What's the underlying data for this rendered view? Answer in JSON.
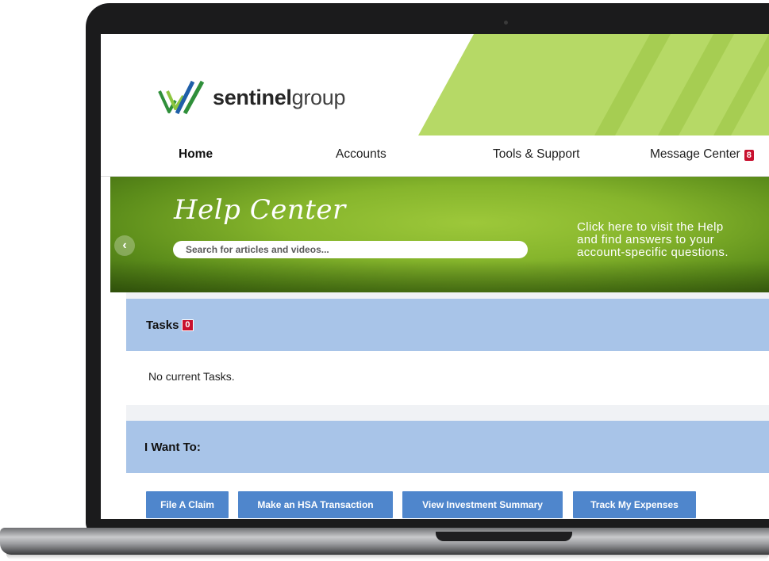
{
  "brand": {
    "name_bold": "sentinel",
    "name_light": "group",
    "colors": {
      "green": "#8dc63f",
      "dark_green": "#2e7d32",
      "blue": "#1f5fa8"
    }
  },
  "nav": {
    "items": [
      {
        "label": "Home",
        "active": true
      },
      {
        "label": "Accounts"
      },
      {
        "label": "Tools & Support"
      },
      {
        "label": "Message Center",
        "badge": "8"
      }
    ]
  },
  "banner": {
    "title": "Help Center",
    "search_placeholder": "Search for articles and videos...",
    "text_lines": [
      "Click here to visit the Help",
      "and find answers to your",
      "account-specific questions."
    ],
    "prev_icon": "chevron-left-icon"
  },
  "tasks": {
    "title": "Tasks",
    "count": "0",
    "empty_text": "No current Tasks."
  },
  "i_want_to": {
    "title": "I Want To:",
    "buttons": [
      "File A Claim",
      "Make an HSA Transaction",
      "View Investment Summary",
      "Track My Expenses"
    ]
  },
  "colors": {
    "panel_header": "#a8c4e8",
    "button": "#4f86cc",
    "badge": "#c8102e"
  }
}
